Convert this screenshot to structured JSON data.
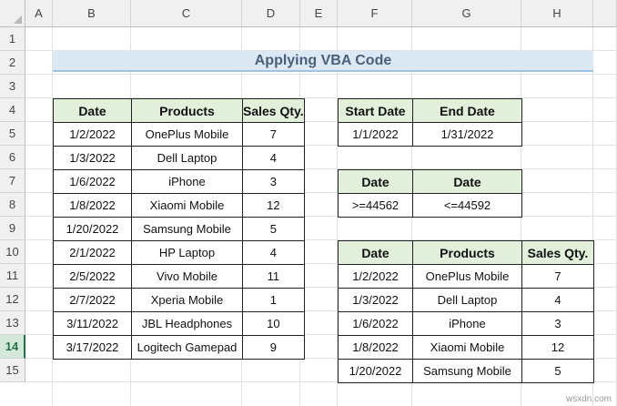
{
  "columns": [
    "A",
    "B",
    "C",
    "D",
    "E",
    "F",
    "G",
    "H"
  ],
  "rows": [
    "1",
    "2",
    "3",
    "4",
    "5",
    "6",
    "7",
    "8",
    "9",
    "10",
    "11",
    "12",
    "13",
    "14",
    "15"
  ],
  "selected_row": "14",
  "title": "Applying VBA Code",
  "main_table": {
    "headers": [
      "Date",
      "Products",
      "Sales Qty."
    ],
    "rows": [
      [
        "1/2/2022",
        "OnePlus Mobile",
        "7"
      ],
      [
        "1/3/2022",
        "Dell Laptop",
        "4"
      ],
      [
        "1/6/2022",
        "iPhone",
        "3"
      ],
      [
        "1/8/2022",
        "Xiaomi Mobile",
        "12"
      ],
      [
        "1/20/2022",
        "Samsung Mobile",
        "5"
      ],
      [
        "2/1/2022",
        "HP Laptop",
        "4"
      ],
      [
        "2/5/2022",
        "Vivo Mobile",
        "11"
      ],
      [
        "2/7/2022",
        "Xperia Mobile",
        "1"
      ],
      [
        "3/11/2022",
        "JBL Headphones",
        "10"
      ],
      [
        "3/17/2022",
        "Logitech Gamepad",
        "9"
      ]
    ]
  },
  "date_range_table": {
    "headers": [
      "Start Date",
      "End Date"
    ],
    "rows": [
      [
        "1/1/2022",
        "1/31/2022"
      ]
    ]
  },
  "criteria_table": {
    "headers": [
      "Date",
      "Date"
    ],
    "rows": [
      [
        ">=44562",
        "<=44592"
      ]
    ]
  },
  "result_table": {
    "headers": [
      "Date",
      "Products",
      "Sales Qty."
    ],
    "rows": [
      [
        "1/2/2022",
        "OnePlus Mobile",
        "7"
      ],
      [
        "1/3/2022",
        "Dell Laptop",
        "4"
      ],
      [
        "1/6/2022",
        "iPhone",
        "3"
      ],
      [
        "1/8/2022",
        "Xiaomi Mobile",
        "12"
      ],
      [
        "1/20/2022",
        "Samsung Mobile",
        "5"
      ]
    ]
  },
  "watermark": "wsxdn.com",
  "colors": {
    "header_fill": "#e2efda",
    "title_fill": "#dce9f5",
    "title_text": "#4a5f7a",
    "selection": "#217346"
  }
}
